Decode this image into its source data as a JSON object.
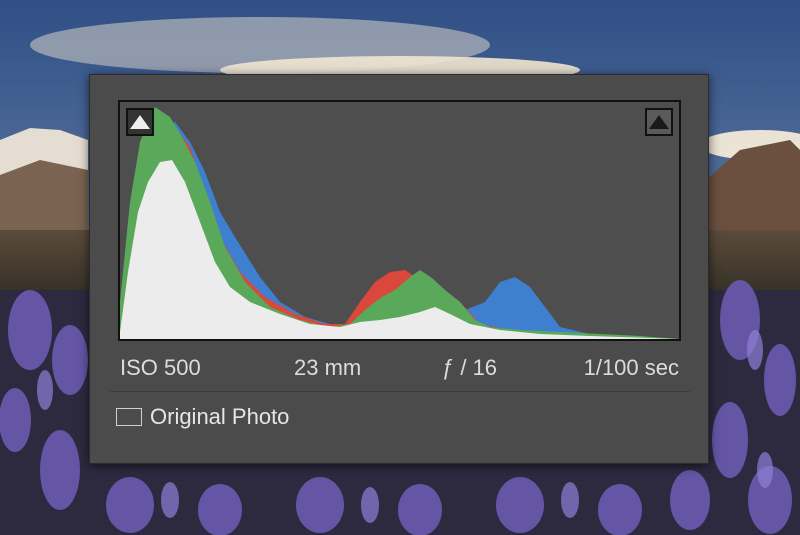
{
  "histogram": {
    "shadow_clipping_label": "",
    "highlight_clipping_label": "",
    "colors": {
      "red": "#d9483b",
      "green": "#5aa85a",
      "blue": "#3f7fd0",
      "white": "#ececec",
      "background": "#4e4e4e"
    }
  },
  "camera_info": {
    "iso": "ISO 500",
    "focal_length": "23 mm",
    "aperture": "ƒ / 16",
    "shutter": "1/100 sec"
  },
  "original_photo": {
    "label": "Original Photo",
    "checked": false
  }
}
